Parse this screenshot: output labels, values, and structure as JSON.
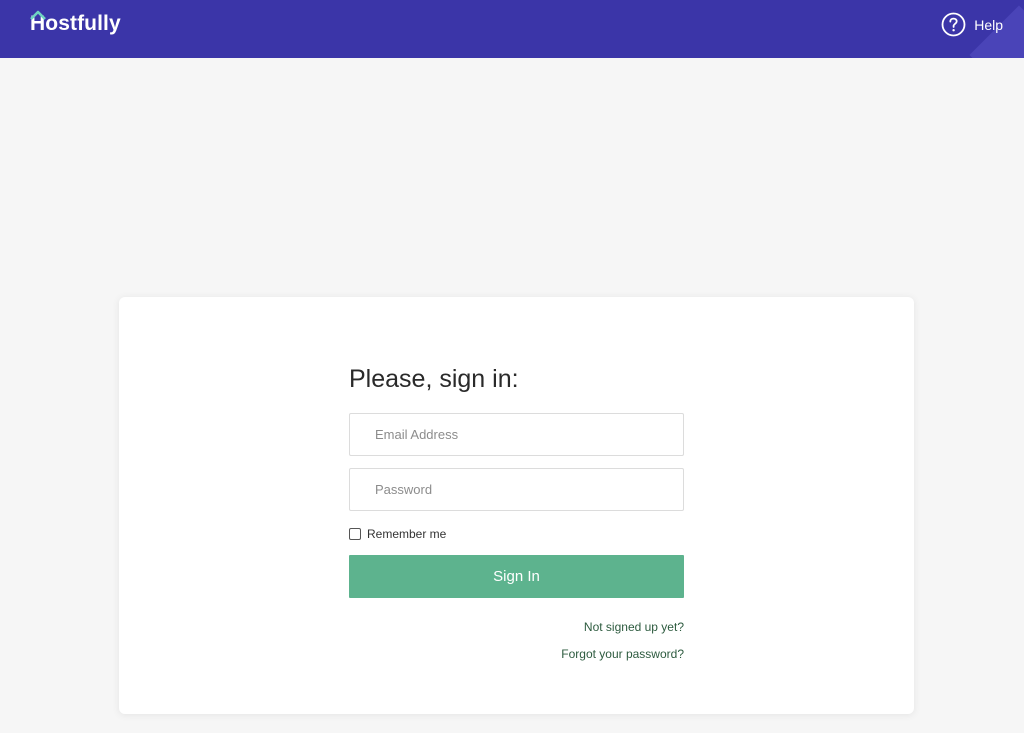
{
  "header": {
    "logo_text": "Hostfully",
    "help_label": "Help",
    "help_icon": "question-circle-icon",
    "background_color": "#3b35a8"
  },
  "login": {
    "heading": "Please, sign in:",
    "email_placeholder": "Email Address",
    "email_value": "",
    "password_placeholder": "Password",
    "password_value": "",
    "remember_label": "Remember me",
    "remember_checked": false,
    "signin_label": "Sign In",
    "signin_color": "#5db38e",
    "signup_link": "Not signed up yet?",
    "forgot_link": "Forgot your password?"
  }
}
